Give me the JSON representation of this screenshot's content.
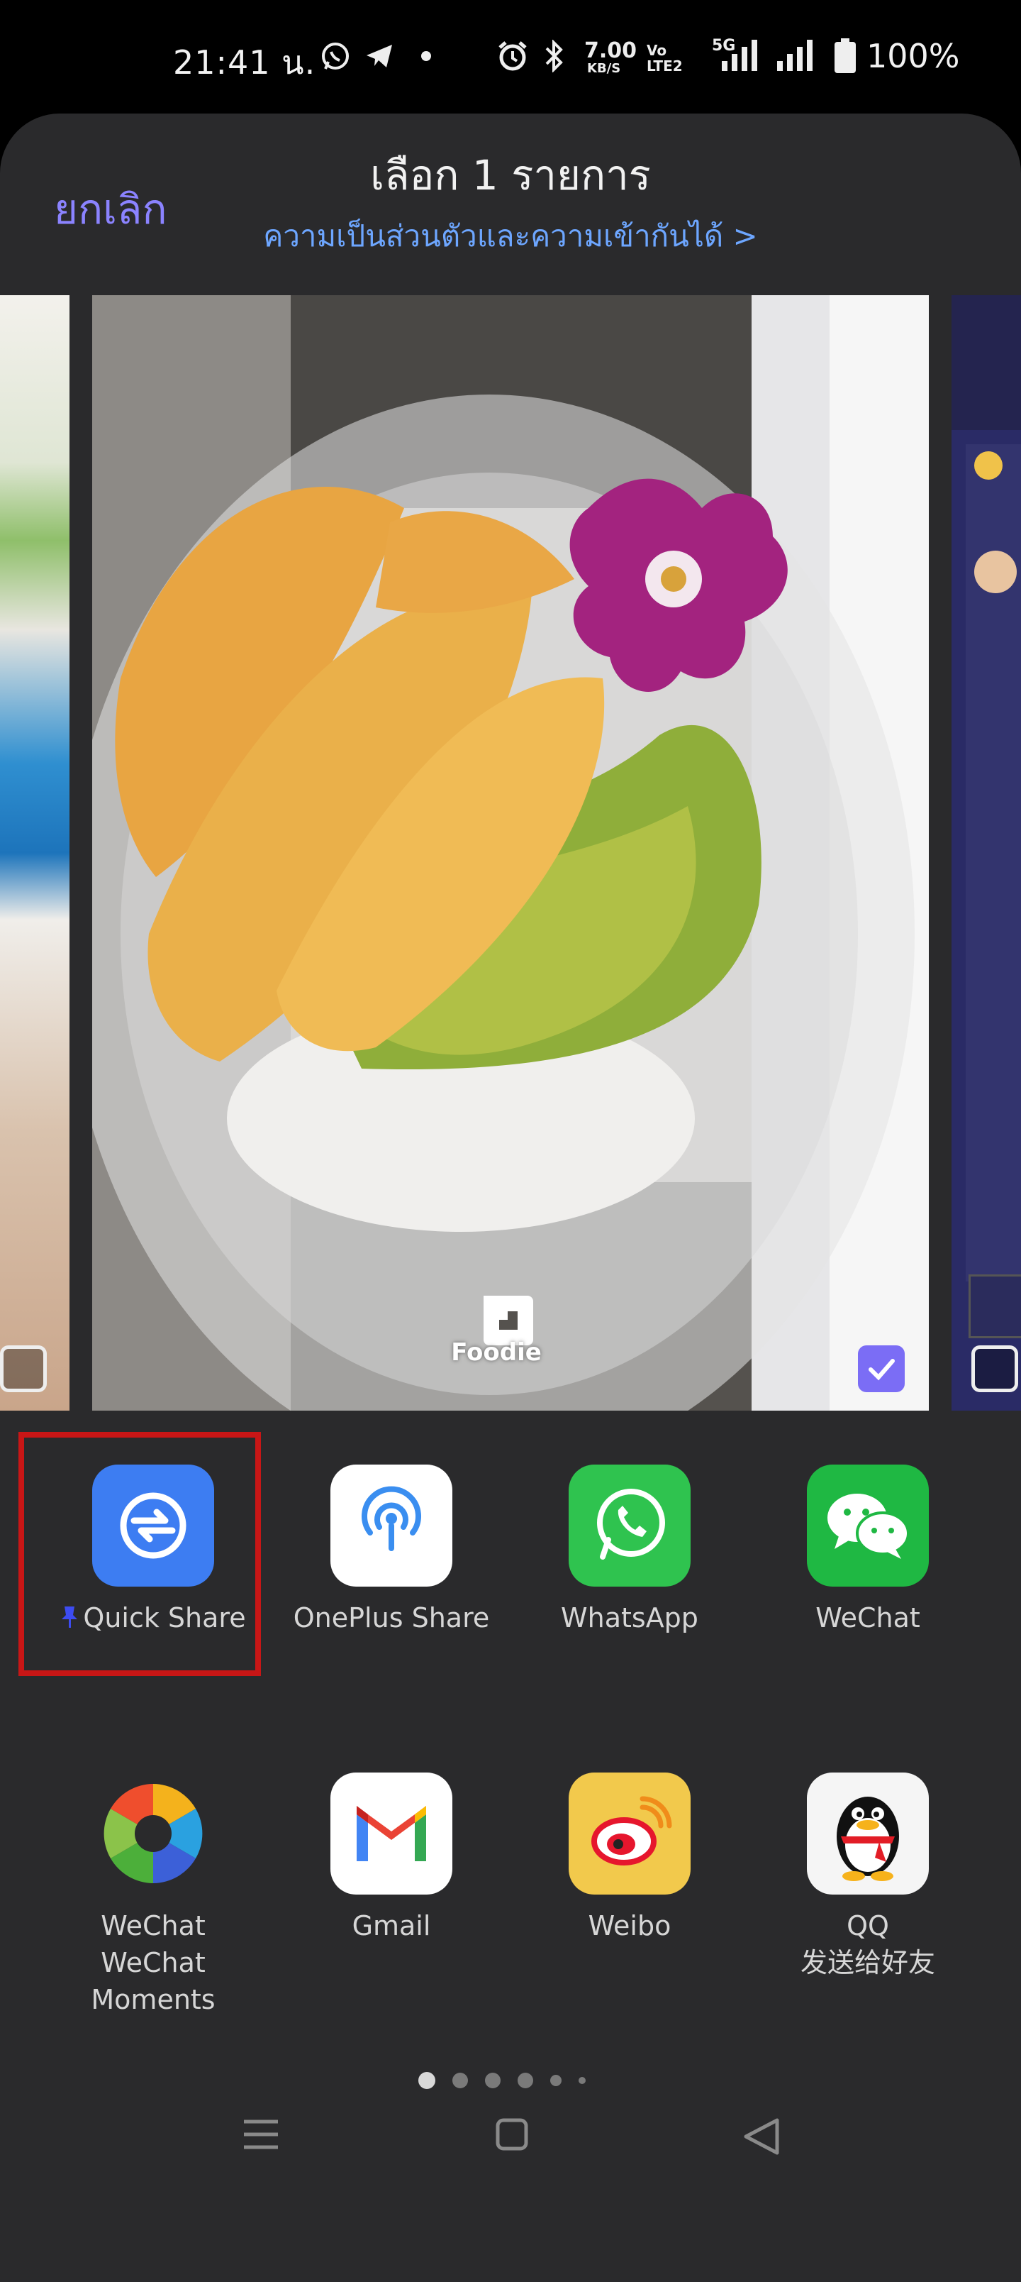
{
  "status_bar": {
    "time": "21:41 น.",
    "speed_value": "7.00",
    "speed_unit": "KB/S",
    "volte": "Vo LTE2",
    "network": "5G",
    "battery": "100%",
    "icons": [
      "whatsapp-icon",
      "telegram-icon",
      "dot-icon",
      "alarm-icon",
      "bluetooth-icon",
      "signal-icon",
      "signal-icon",
      "battery-icon"
    ]
  },
  "header": {
    "title": "เลือก 1 รายการ",
    "cancel": "ยกเลิก",
    "privacy_link": "ความเป็นส่วนตัวและความเข้ากันได้ >"
  },
  "preview": {
    "center_badge": "Foodie",
    "selected": true
  },
  "apps_row1": [
    {
      "label": "Quick Share",
      "pinned": true
    },
    {
      "label": "OnePlus Share"
    },
    {
      "label": "WhatsApp"
    },
    {
      "label": "WeChat"
    }
  ],
  "apps_row2": [
    {
      "label": "WeChat",
      "sub": "WeChat Moments"
    },
    {
      "label": "Gmail"
    },
    {
      "label": "Weibo"
    },
    {
      "label": "QQ",
      "sub": "发送给好友"
    }
  ],
  "colors": {
    "accent": "#8b83ff",
    "link": "#6da6ff",
    "highlight": "#c81616",
    "sheet_bg": "#2a2a2c"
  }
}
